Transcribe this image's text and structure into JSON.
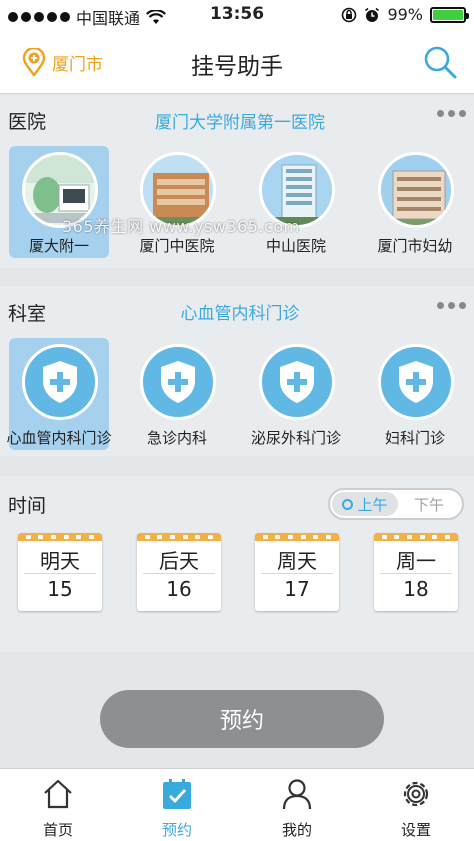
{
  "status_bar": {
    "carrier": "中国联通",
    "time": "13:56",
    "battery": "99%"
  },
  "nav": {
    "city": "厦门市",
    "title": "挂号助手",
    "search_icon": "search-icon",
    "pin_icon": "map-pin-icon"
  },
  "hospital_section": {
    "label": "医院",
    "selected": "厦门大学附属第一医院",
    "items": [
      {
        "name": "厦大附一",
        "selected": true
      },
      {
        "name": "厦门中医院",
        "selected": false
      },
      {
        "name": "中山医院",
        "selected": false
      },
      {
        "name": "厦门市妇幼",
        "selected": false
      }
    ]
  },
  "department_section": {
    "label": "科室",
    "selected": "心血管内科门诊",
    "items": [
      {
        "name": "心血管内科门诊",
        "selected": true
      },
      {
        "name": "急诊内科",
        "selected": false
      },
      {
        "name": "泌尿外科门诊",
        "selected": false
      },
      {
        "name": "妇科门诊",
        "selected": false
      }
    ]
  },
  "time_section": {
    "label": "时间",
    "toggle": {
      "morning": "上午",
      "afternoon": "下午",
      "selected": "上午"
    },
    "days": [
      {
        "day": "明天",
        "date": "15"
      },
      {
        "day": "后天",
        "date": "16"
      },
      {
        "day": "周天",
        "date": "17"
      },
      {
        "day": "周一",
        "date": "18"
      }
    ]
  },
  "book_button": {
    "label": "预约"
  },
  "tabbar": {
    "items": [
      {
        "label": "首页",
        "icon": "home-icon",
        "active": false
      },
      {
        "label": "预约",
        "icon": "calendar-check-icon",
        "active": true
      },
      {
        "label": "我的",
        "icon": "user-icon",
        "active": false
      },
      {
        "label": "设置",
        "icon": "gear-icon",
        "active": false
      }
    ]
  },
  "watermark": "365养生网 www.ysw365.com",
  "colors": {
    "accent": "#3aa9dc",
    "city": "#f0a11e",
    "selected_bg": "#a6d1ee",
    "calendar_top": "#f3b046",
    "button": "#8d8f91"
  }
}
